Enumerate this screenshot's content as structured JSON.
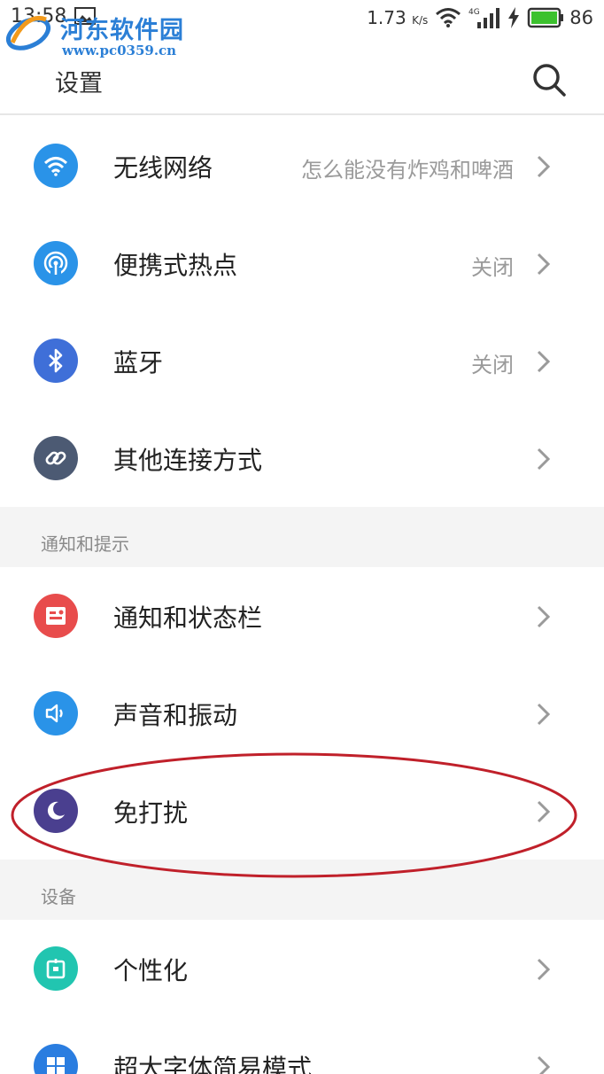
{
  "status_bar": {
    "time": "13:58",
    "speed": "1.73",
    "speed_unit": "K/s",
    "network": "4G",
    "battery": "86"
  },
  "watermark": {
    "title": "河东软件园",
    "url": "www.pc0359.cn"
  },
  "header": {
    "title": "设置"
  },
  "rows": {
    "wifi": {
      "label": "无线网络",
      "value": "怎么能没有炸鸡和啤酒"
    },
    "hotspot": {
      "label": "便携式热点",
      "value": "关闭"
    },
    "bluetooth": {
      "label": "蓝牙",
      "value": "关闭"
    },
    "other": {
      "label": "其他连接方式"
    },
    "notification": {
      "label": "通知和状态栏"
    },
    "sound": {
      "label": "声音和振动"
    },
    "dnd": {
      "label": "免打扰"
    },
    "personalize": {
      "label": "个性化"
    },
    "bigfont": {
      "label": "超大字体简易模式"
    }
  },
  "sections": {
    "notify": "通知和提示",
    "device": "设备"
  },
  "colors": {
    "wifi": "#2a93e8",
    "hotspot": "#2a93e8",
    "bluetooth": "#3f6fd8",
    "other": "#4c5a73",
    "notification": "#e84c4c",
    "sound": "#2a93e8",
    "dnd": "#4a3f8f",
    "personalize": "#21c5b0",
    "bigfont": "#2a7de0",
    "annotation": "#c0202a"
  },
  "icons": {
    "wifi": "wifi-icon",
    "hotspot": "hotspot-icon",
    "bluetooth": "bluetooth-icon",
    "other": "link-icon",
    "notification": "notification-icon",
    "sound": "speaker-icon",
    "dnd": "moon-icon",
    "personalize": "theme-icon",
    "bigfont": "grid-icon"
  }
}
